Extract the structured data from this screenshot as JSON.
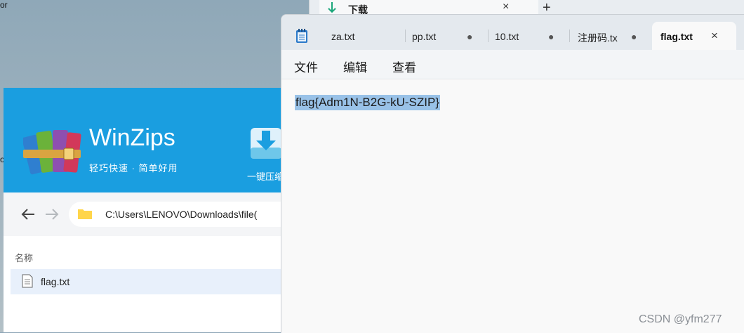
{
  "desktop": {
    "fragment_top": "or",
    "fragment_mid": "o"
  },
  "bg_window": {
    "tab_label": "下载",
    "close": "×",
    "new_tab": "+"
  },
  "winzips": {
    "title": "WinZips",
    "subtitle": "轻巧快速 · 简单好用",
    "extract_label": "一键压缩",
    "path": "C:\\Users\\LENOVO\\Downloads\\file(",
    "column_name": "名称",
    "files": [
      {
        "name": "flag.txt"
      }
    ]
  },
  "notepad": {
    "tabs": [
      {
        "label": "za.txt",
        "modified": false
      },
      {
        "label": "pp.txt",
        "modified": true
      },
      {
        "label": "10.txt",
        "modified": true
      },
      {
        "label": "注册码.tx",
        "modified": true
      },
      {
        "label": "flag.txt",
        "active": true
      }
    ],
    "modified_marker": "●",
    "close": "×",
    "menu": [
      "文件",
      "编辑",
      "查看"
    ],
    "content": "flag{Adm1N-B2G-kU-SZIP}"
  },
  "watermark": "CSDN @yfm277",
  "colors": {
    "winzips_header": "#1a9ee0",
    "selection": "#99c2e8",
    "tab_bar": "#e4e9ee"
  }
}
